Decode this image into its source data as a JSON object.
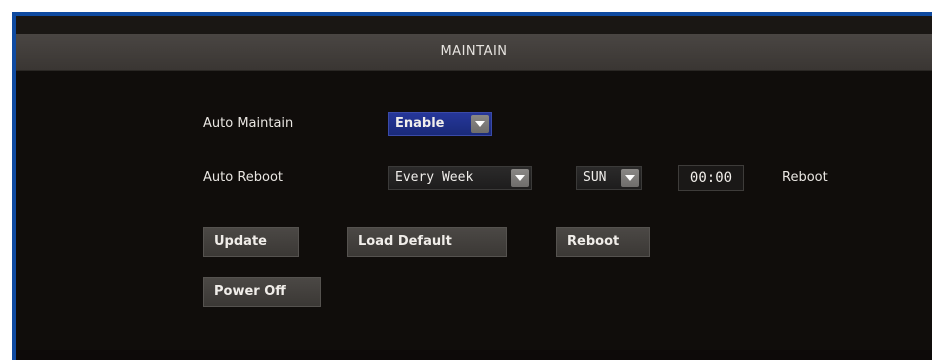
{
  "title": "MAINTAIN",
  "auto_maintain": {
    "label": "Auto Maintain",
    "value": "Enable"
  },
  "auto_reboot": {
    "label": "Auto Reboot",
    "frequency": "Every Week",
    "day": "SUN",
    "time": "00:00",
    "action_label": "Reboot"
  },
  "buttons": {
    "update": "Update",
    "load_default": "Load Default",
    "reboot": "Reboot",
    "power_off": "Power Off"
  },
  "colors": {
    "frame_blue": "#0f4aa0",
    "panel_bg": "#100d0b",
    "title_bar": "#4a4643",
    "selected_dropdown": "#26379a"
  },
  "icons": {
    "dropdown_arrow": "chevron-down-icon"
  }
}
